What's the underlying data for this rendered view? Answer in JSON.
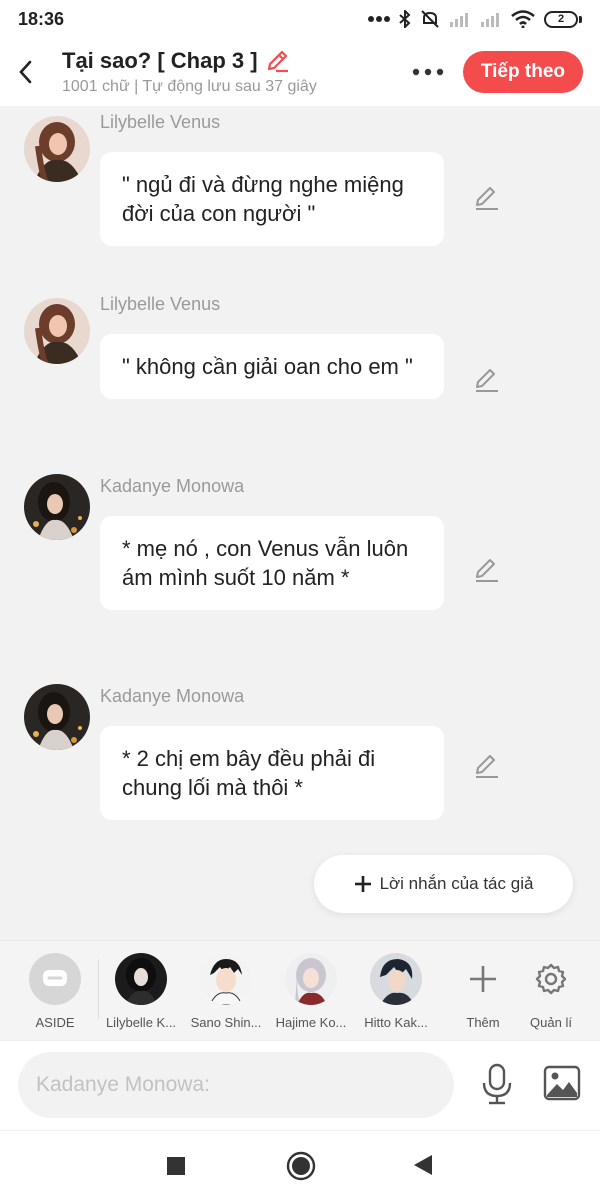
{
  "status_bar": {
    "time": "18:36",
    "battery": "2"
  },
  "header": {
    "title": "Tại sao? [ Chap 3 ]",
    "subtitle": "1001 chữ | Tự động lưu sau 37 giây",
    "next_label": "Tiếp theo"
  },
  "messages": [
    {
      "name": "Lilybelle Venus",
      "text": "\" ngủ đi và đừng nghe miệng đời của con người \""
    },
    {
      "name": "Lilybelle Venus",
      "text": "\" không cần giải oan cho em \""
    },
    {
      "name": "Kadanye Monowa",
      "text": "* mẹ nó , con Venus vẫn luôn ám mình suốt 10 năm *"
    },
    {
      "name": "Kadanye Monowa",
      "text": "* 2 chị em bây đều phải đi chung lối mà thôi *"
    }
  ],
  "author_note_label": "Lời nhắn của tác giả",
  "characters": {
    "aside": "ASIDE",
    "items": [
      "Lilybelle K...",
      "Sano Shin...",
      "Hajime Ko...",
      "Hitto Kak..."
    ],
    "add_label": "Thêm",
    "manage_label": "Quản lí"
  },
  "input": {
    "placeholder": "Kadanye Monowa:"
  },
  "colors": {
    "accent": "#f44b4d",
    "background": "#f2f2f2"
  }
}
